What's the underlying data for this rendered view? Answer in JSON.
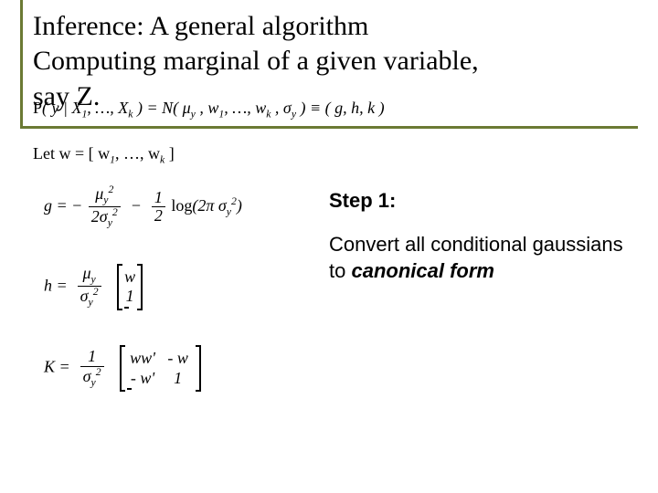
{
  "title_line1": "Inference: A general algorithm",
  "title_line2": "Computing marginal of a given variable,",
  "title_line3": "say Z.",
  "cond_gauss": "P( y | X₁, …, X_k ) = N( μ_y , w₁, …, w_k , σ_y ) ≡ ( g, h, k )",
  "let_line": "Let w = [ w₁, …, w_k ]",
  "g_lhs": "g = −",
  "g_num": "μ_y²",
  "g_den": "2σ_y²",
  "g_mid": " − ",
  "g_half_num": "1",
  "g_half_den": "2",
  "g_log": " log(2π σ_y²)",
  "h_lhs": "h = ",
  "h_num": "μ_y",
  "h_den": "σ_y²",
  "h_vec_top": "w",
  "h_vec_bot": "1",
  "K_lhs": "K = ",
  "K_num": "1",
  "K_den": "σ_y²",
  "K_m11": "ww'",
  "K_m12": "- w",
  "K_m21": "- w'",
  "K_m22": "1",
  "step_head": "Step 1:",
  "step_body_1": "Convert all conditional gaussians to ",
  "step_body_em": "canonical form"
}
